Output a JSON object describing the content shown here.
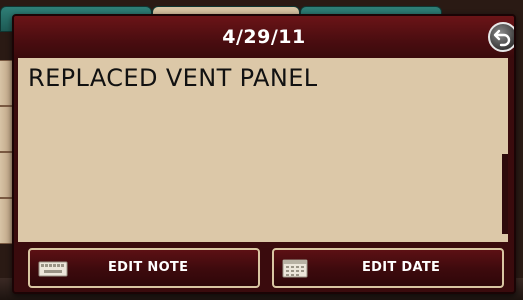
{
  "dialog": {
    "title": "4/29/11",
    "note_text": "REPLACED VENT PANEL"
  },
  "footer": {
    "edit_note_label": "EDIT NOTE",
    "edit_date_label": "EDIT DATE"
  },
  "icons": {
    "back": "back-arrow-icon",
    "edit_note": "keyboard-icon",
    "edit_date": "calendar-icon"
  },
  "colors": {
    "title_bar": "#5a1013",
    "note_background": "#dcc8a8",
    "button_border": "#d9c6a2",
    "text_light": "#ffffff",
    "text_dark": "#111111"
  }
}
